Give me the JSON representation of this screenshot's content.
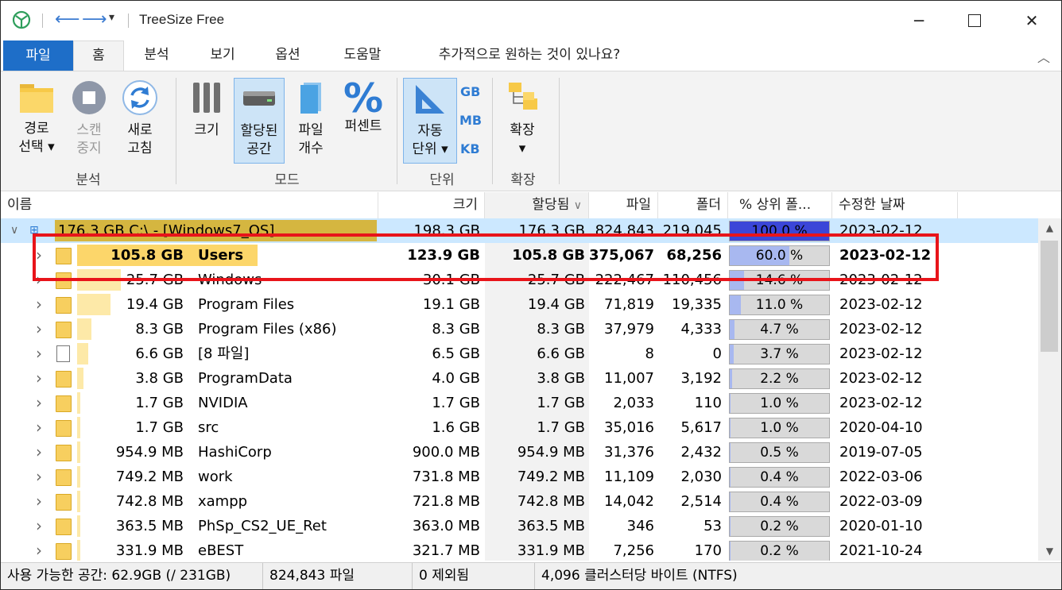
{
  "window": {
    "title": "TreeSize Free",
    "minimize_icon": "minimize-icon",
    "maximize_icon": "maximize-icon",
    "close_icon": "close-icon"
  },
  "tabs": [
    {
      "label": "파일"
    },
    {
      "label": "홈"
    },
    {
      "label": "분석"
    },
    {
      "label": "보기"
    },
    {
      "label": "옵션"
    },
    {
      "label": "도움말"
    },
    {
      "label": "추가적으로 원하는 것이 있나요?"
    }
  ],
  "ribbon": {
    "path_select": [
      "경로",
      "선택"
    ],
    "scan_stop": [
      "스캔",
      "중지"
    ],
    "refresh": [
      "새로",
      "고침"
    ],
    "group_analysis": "분석",
    "size": "크기",
    "allocated": [
      "할당된",
      "공간"
    ],
    "file_count": [
      "파일",
      "개수"
    ],
    "percent": "퍼센트",
    "group_mode": "모드",
    "auto_unit": [
      "자동",
      "단위"
    ],
    "unit_gb": "GB",
    "unit_mb": "MB",
    "unit_kb": "KB",
    "group_unit": "단위",
    "expand": "확장",
    "group_expand": "확장"
  },
  "columns": {
    "name": "이름",
    "size": "크기",
    "allocated": "할당됨",
    "files": "파일",
    "folders": "폴더",
    "percent_parent": "% 상위 폴...",
    "modified": "수정한 날짜"
  },
  "rows": [
    {
      "size_label": "176.3 GB",
      "name": "C:\\ - [Windows7_OS]",
      "size": "198.3 GB",
      "allocated": "176.3 GB",
      "files": "824,843",
      "folders": "219,045",
      "pct": "100.0 %",
      "pct_value": 100.0,
      "modified": "2023-02-12",
      "kind": "root"
    },
    {
      "size_label": "105.8 GB",
      "name": "Users",
      "size": "123.9 GB",
      "allocated": "105.8 GB",
      "files": "375,067",
      "folders": "68,256",
      "pct": "60.0 %",
      "pct_value": 60.0,
      "modified": "2023-02-12",
      "kind": "folder"
    },
    {
      "size_label": "25.7 GB",
      "name": "Windows",
      "size": "30.1 GB",
      "allocated": "25.7 GB",
      "files": "222,467",
      "folders": "110,456",
      "pct": "14.6 %",
      "pct_value": 14.6,
      "modified": "2023-02-12",
      "kind": "folder"
    },
    {
      "size_label": "19.4 GB",
      "name": "Program Files",
      "size": "19.1 GB",
      "allocated": "19.4 GB",
      "files": "71,819",
      "folders": "19,335",
      "pct": "11.0 %",
      "pct_value": 11.0,
      "modified": "2023-02-12",
      "kind": "folder"
    },
    {
      "size_label": "8.3 GB",
      "name": "Program Files (x86)",
      "size": "8.3 GB",
      "allocated": "8.3 GB",
      "files": "37,979",
      "folders": "4,333",
      "pct": "4.7 %",
      "pct_value": 4.7,
      "modified": "2023-02-12",
      "kind": "folder"
    },
    {
      "size_label": "6.6 GB",
      "name": "[8 파일]",
      "size": "6.5 GB",
      "allocated": "6.6 GB",
      "files": "8",
      "folders": "0",
      "pct": "3.7 %",
      "pct_value": 3.7,
      "modified": "2023-02-12",
      "kind": "file"
    },
    {
      "size_label": "3.8 GB",
      "name": "ProgramData",
      "size": "4.0 GB",
      "allocated": "3.8 GB",
      "files": "11,007",
      "folders": "3,192",
      "pct": "2.2 %",
      "pct_value": 2.2,
      "modified": "2023-02-12",
      "kind": "folder"
    },
    {
      "size_label": "1.7 GB",
      "name": "NVIDIA",
      "size": "1.7 GB",
      "allocated": "1.7 GB",
      "files": "2,033",
      "folders": "110",
      "pct": "1.0 %",
      "pct_value": 1.0,
      "modified": "2023-02-12",
      "kind": "folder"
    },
    {
      "size_label": "1.7 GB",
      "name": "src",
      "size": "1.6 GB",
      "allocated": "1.7 GB",
      "files": "35,016",
      "folders": "5,617",
      "pct": "1.0 %",
      "pct_value": 1.0,
      "modified": "2020-04-10",
      "kind": "folder"
    },
    {
      "size_label": "954.9 MB",
      "name": "HashiCorp",
      "size": "900.0 MB",
      "allocated": "954.9 MB",
      "files": "31,376",
      "folders": "2,432",
      "pct": "0.5 %",
      "pct_value": 0.5,
      "modified": "2019-07-05",
      "kind": "folder"
    },
    {
      "size_label": "749.2 MB",
      "name": "work",
      "size": "731.8 MB",
      "allocated": "749.2 MB",
      "files": "11,109",
      "folders": "2,030",
      "pct": "0.4 %",
      "pct_value": 0.4,
      "modified": "2022-03-06",
      "kind": "folder"
    },
    {
      "size_label": "742.8 MB",
      "name": "xampp",
      "size": "721.8 MB",
      "allocated": "742.8 MB",
      "files": "14,042",
      "folders": "2,514",
      "pct": "0.4 %",
      "pct_value": 0.4,
      "modified": "2022-03-09",
      "kind": "folder"
    },
    {
      "size_label": "363.5 MB",
      "name": "PhSp_CS2_UE_Ret",
      "size": "363.0 MB",
      "allocated": "363.5 MB",
      "files": "346",
      "folders": "53",
      "pct": "0.2 %",
      "pct_value": 0.2,
      "modified": "2020-01-10",
      "kind": "folder"
    },
    {
      "size_label": "331.9 MB",
      "name": "eBEST",
      "size": "321.7 MB",
      "allocated": "331.9 MB",
      "files": "7,256",
      "folders": "170",
      "pct": "0.2 %",
      "pct_value": 0.2,
      "modified": "2021-10-24",
      "kind": "folder"
    }
  ],
  "status": {
    "free_space": "사용 가능한 공간: 62.9GB  (/ 231GB)",
    "files": "824,843 파일",
    "excluded": "0 제외됨",
    "cluster": "4,096 클러스터당 바이트 (NTFS)"
  },
  "colors": {
    "accent": "#1e6ec8",
    "selection": "#cce8ff",
    "highlight_box": "#e8141a",
    "size_bar": "#fde9a8",
    "pct_fill": "#a8b8f0"
  }
}
